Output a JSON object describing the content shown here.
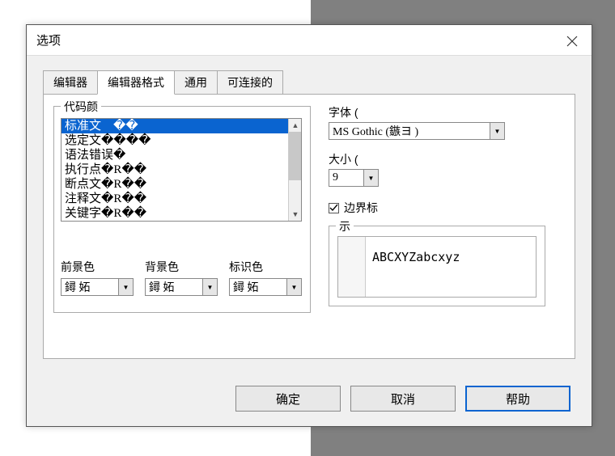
{
  "dialog": {
    "title": "选项"
  },
  "tabs": [
    {
      "label": "编辑器"
    },
    {
      "label": "编辑器格式"
    },
    {
      "label": "通用"
    },
    {
      "label": "可连接的"
    }
  ],
  "codecolors": {
    "legend": "代码颜",
    "items": [
      "标准文    ��",
      "选定文����",
      "语法错误�",
      "执行点�R��",
      "断点文�R��",
      "注释文�R��",
      "关键字�R��"
    ],
    "selected_index": 0
  },
  "color_pickers": {
    "fg": {
      "label": "前景色",
      "value": "鐞   妬"
    },
    "bg": {
      "label": "背景色",
      "value": "鐞   妬"
    },
    "ind": {
      "label": "标识色",
      "value": "鐞   妬"
    }
  },
  "font": {
    "label": "字体 (",
    "value": "MS Gothic (鏃ヨ   )"
  },
  "size": {
    "label": "大小 (",
    "value": "9"
  },
  "margin_checkbox": {
    "label": "边界标",
    "checked": true
  },
  "preview": {
    "legend": "示",
    "text": "ABCXYZabcxyz"
  },
  "buttons": {
    "ok": "确定",
    "cancel": "取消",
    "help": "帮助"
  }
}
